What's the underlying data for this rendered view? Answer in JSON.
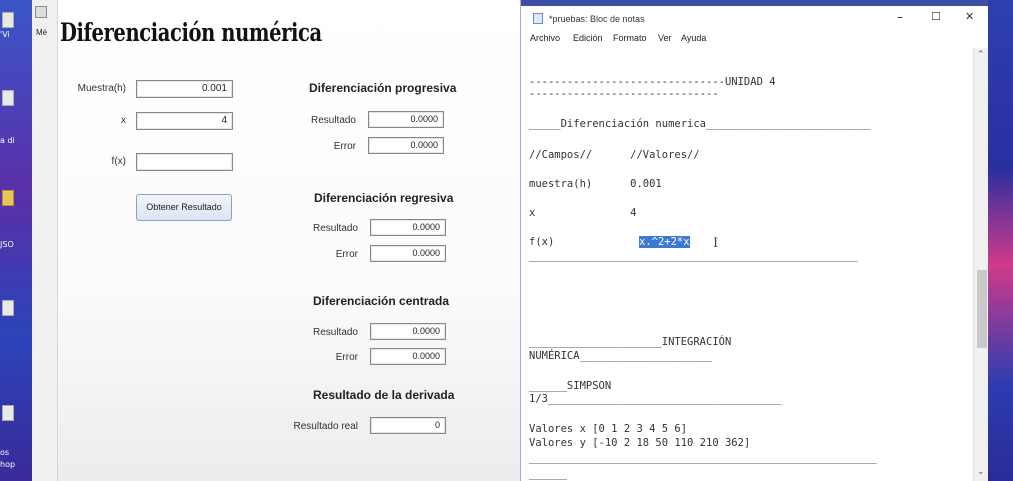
{
  "desktop": {
    "left_labels": [
      "'Vi",
      "a di",
      "JSO",
      "os",
      "hop"
    ]
  },
  "app": {
    "edge_label": "Mé",
    "title": "Diferenciación numérica",
    "inputs": {
      "muestra_label": "Muestra(h)",
      "muestra_value": "0.001",
      "x_label": "x",
      "x_value": "4",
      "fx_label": "f(x)",
      "fx_value": ""
    },
    "button_label": "Obtener Resultado",
    "sections": {
      "progresiva": {
        "title": "Diferenciación progresiva",
        "resultado_label": "Resultado",
        "resultado_value": "0.0000",
        "error_label": "Error",
        "error_value": "0.0000"
      },
      "regresiva": {
        "title": "Diferenciación regresiva",
        "resultado_label": "Resultado",
        "resultado_value": "0.0000",
        "error_label": "Error",
        "error_value": "0.0000"
      },
      "centrada": {
        "title": "Diferenciación centrada",
        "resultado_label": "Resultado",
        "resultado_value": "0.0000",
        "error_label": "Error",
        "error_value": "0.0000"
      },
      "derivada": {
        "title": "Resultado de la derivada",
        "real_label": "Resultado real",
        "real_value": "0"
      }
    }
  },
  "notepad": {
    "title": "*pruebas: Bloc de notas",
    "controls": {
      "minimize": "–",
      "maximize": "☐",
      "close": "✕"
    },
    "menu": [
      "Archivo",
      "Edición",
      "Formato",
      "Ver",
      "Ayuda"
    ],
    "lines": {
      "unidad": "-------------------------------UNIDAD 4",
      "unidad_under": "------------------------------",
      "dif_header": "_____Diferenciación numerica__________________________",
      "campos_header": "//Campos//      //Valores//",
      "muestra_row": "muestra(h)      0.001",
      "x_row": "x               4",
      "fx_label": "f(x)",
      "fx_value": "x.^2+2*x",
      "rule": "____________________________________________________",
      "integracion": "_____________________INTEGRACIÓN",
      "numerica": "NUMÉRICA_____________________",
      "simpson": "______SIMPSON",
      "simpson_frac": "1/3_____________________________________",
      "valores_x": "Valores x [0 1 2 3 4 5 6]",
      "valores_y": "Valores y [-10 2 18 50 110 210 362]",
      "rule2": "_______________________________________________________",
      "last": "______"
    },
    "scroll": {
      "up": "⌃",
      "down": "⌄"
    }
  }
}
